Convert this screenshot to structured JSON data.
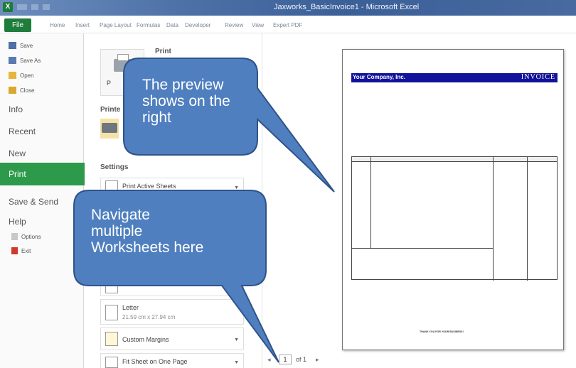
{
  "window": {
    "title": "Jaxworks_BasicInvoice1 - Microsoft Excel",
    "app_icon": "X"
  },
  "ribbon": {
    "file_tab": "File",
    "tabs": [
      "Home",
      "Insert",
      "Page Layout",
      "Formulas",
      "Data",
      "Developer",
      "Review",
      "View",
      "Expert PDF"
    ]
  },
  "backstage": {
    "small_items": [
      {
        "label": "Save",
        "icon": "save-icon"
      },
      {
        "label": "Save As",
        "icon": "save-as-icon"
      },
      {
        "label": "Open",
        "icon": "open-folder-icon"
      },
      {
        "label": "Close",
        "icon": "close-folder-icon"
      }
    ],
    "big_items": [
      "Info",
      "Recent",
      "New"
    ],
    "selected": "Print",
    "lower_items": [
      "Save & Send",
      "Help"
    ],
    "footer_items": [
      {
        "label": "Options",
        "icon": "options-icon"
      },
      {
        "label": "Exit",
        "icon": "exit-icon"
      }
    ]
  },
  "print_panel": {
    "heading": "Print",
    "print_button": "P",
    "printer_heading": "Printe",
    "settings_heading": "Settings",
    "active_sheets": "Print Active Sheets",
    "paper_size": "Letter",
    "paper_dims": "21.59 cm x 27.94 cm",
    "margins": "Custom Margins",
    "scaling": "Fit Sheet on One Page"
  },
  "preview": {
    "page_number": "1",
    "page_of": "of 1",
    "invoice": {
      "company": "Your Company, Inc.",
      "title": "INVOICE",
      "footer": "THANK YOU FOR YOUR BUSINESS!"
    }
  },
  "callouts": {
    "preview": [
      "The preview",
      "shows on the",
      "right"
    ],
    "navigate": [
      "Navigate",
      "multiple",
      "Worksheets here"
    ]
  },
  "colors": {
    "file_tab": "#1e7d3a",
    "print_selected": "#2c9a4a",
    "callout_fill": "#4f7fbf",
    "callout_border": "#30538a",
    "invoice_header": "#12129a"
  }
}
